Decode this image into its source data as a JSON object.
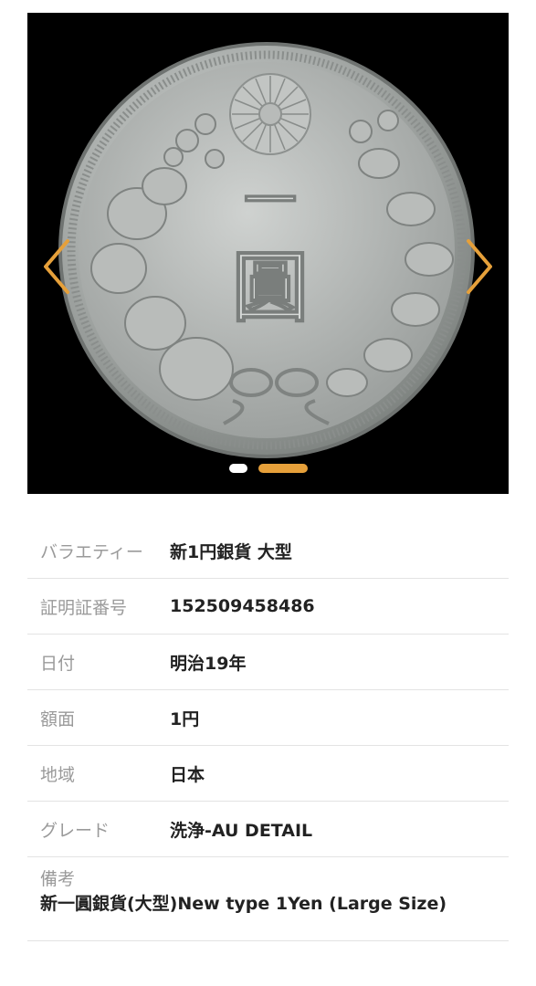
{
  "gallery": {
    "image_icon": "coin-image",
    "prev_icon": "chevron-left-icon",
    "next_icon": "chevron-right-icon",
    "total_slides": 2,
    "active_slide": 2,
    "colors": {
      "background": "#000000",
      "arrow": "#e6a03a",
      "dot_active": "#e6a03a",
      "dot_inactive": "#ffffff"
    },
    "coin_text": {
      "top": "一",
      "bottom": "圓"
    }
  },
  "details": {
    "rows": [
      {
        "label": "バラエティー",
        "value": "新1円銀貨 大型"
      },
      {
        "label": "証明証番号",
        "value": "152509458486"
      },
      {
        "label": "日付",
        "value": "明治19年"
      },
      {
        "label": "額面",
        "value": "1円"
      },
      {
        "label": "地域",
        "value": "日本"
      },
      {
        "label": "グレード",
        "value": "洗浄-AU DETAIL"
      }
    ],
    "note": {
      "label": "備考",
      "value": "新一圓銀貨(大型)New type 1Yen (Large Size)"
    }
  }
}
